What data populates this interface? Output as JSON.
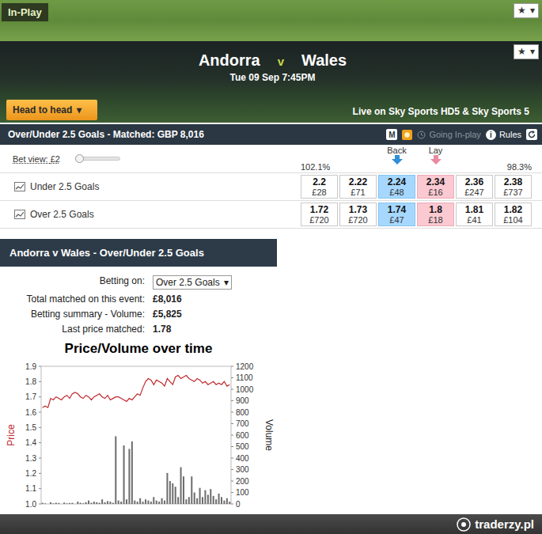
{
  "top_bar": {
    "badge": "In-Play",
    "favourite": {
      "star": "★",
      "arrow": "▾"
    }
  },
  "event": {
    "home": "Andorra",
    "separator": "v",
    "away": "Wales",
    "time": "Tue 09 Sep 7:45PM",
    "favourite": {
      "star": "★",
      "arrow": "▾"
    },
    "head_to_head": {
      "label": "Head to head",
      "arrow": "▾"
    },
    "broadcast": "Live on Sky Sports HD5 & Sky Sports 5"
  },
  "market": {
    "title": "Over/Under 2.5 Goals - Matched: GBP 8,016",
    "tools": {
      "multiples": "M",
      "going_in_play": {
        "label": "Going In-play",
        "disabled": true
      },
      "info": "i",
      "rules": "Rules"
    },
    "bet_view": {
      "label": "Bet view:",
      "value": "£2",
      "level": 0
    },
    "back_label": "Back",
    "lay_label": "Lay",
    "back_book": "102.1%",
    "lay_book": "98.3%",
    "runners": [
      {
        "name": "Under 2.5 Goals",
        "prices": [
          {
            "odds": "2.2",
            "amount": "£28",
            "kind": "back"
          },
          {
            "odds": "2.22",
            "amount": "£71",
            "kind": "back"
          },
          {
            "odds": "2.24",
            "amount": "£48",
            "kind": "bestback"
          },
          {
            "odds": "2.34",
            "amount": "£16",
            "kind": "bestlay"
          },
          {
            "odds": "2.36",
            "amount": "£247",
            "kind": "lay"
          },
          {
            "odds": "2.38",
            "amount": "£737",
            "kind": "lay"
          }
        ]
      },
      {
        "name": "Over 2.5 Goals",
        "prices": [
          {
            "odds": "1.72",
            "amount": "£720",
            "kind": "back"
          },
          {
            "odds": "1.73",
            "amount": "£720",
            "kind": "back"
          },
          {
            "odds": "1.74",
            "amount": "£47",
            "kind": "bestback"
          },
          {
            "odds": "1.8",
            "amount": "£18",
            "kind": "bestlay"
          },
          {
            "odds": "1.81",
            "amount": "£41",
            "kind": "lay"
          },
          {
            "odds": "1.82",
            "amount": "£104",
            "kind": "lay"
          }
        ]
      }
    ]
  },
  "panel": {
    "title": "Andorra v Wales - Over/Under 2.5 Goals",
    "betting_on": {
      "label": "Betting on:",
      "value": "Over 2.5 Goals",
      "arrow": "▾"
    },
    "stats": [
      {
        "label": "Total matched on this event:",
        "value": "£8,016"
      },
      {
        "label": "Betting summary - Volume:",
        "value": "£5,825"
      },
      {
        "label": "Last price matched:",
        "value": "1.78"
      }
    ]
  },
  "chart": {
    "title": "Price/Volume over time",
    "price_axis": {
      "label": "Price",
      "ticks": [
        "1.0",
        "1.1",
        "1.2",
        "1.3",
        "1.4",
        "1.5",
        "1.6",
        "1.7",
        "1.8",
        "1.9"
      ]
    },
    "volume_axis": {
      "label": "Volume",
      "ticks": [
        "0",
        "100",
        "200",
        "300",
        "400",
        "500",
        "600",
        "700",
        "800",
        "900",
        "1000",
        "1100",
        "1200"
      ]
    },
    "price": [
      1.63,
      1.64,
      1.63,
      1.69,
      1.68,
      1.7,
      1.69,
      1.68,
      1.7,
      1.71,
      1.69,
      1.72,
      1.73,
      1.72,
      1.7,
      1.69,
      1.71,
      1.7,
      1.68,
      1.7,
      1.71,
      1.72,
      1.7,
      1.69,
      1.71,
      1.68,
      1.69,
      1.7,
      1.7,
      1.69,
      1.68,
      1.67,
      1.69,
      1.68,
      1.7,
      1.72,
      1.71,
      1.76,
      1.8,
      1.82,
      1.81,
      1.78,
      1.81,
      1.8,
      1.79,
      1.77,
      1.82,
      1.8,
      1.78,
      1.83,
      1.84,
      1.82,
      1.83,
      1.84,
      1.82,
      1.81,
      1.8,
      1.82,
      1.81,
      1.79,
      1.8,
      1.78,
      1.79,
      1.8,
      1.78,
      1.79,
      1.78,
      1.8,
      1.77,
      1.78
    ],
    "volume": [
      10,
      5,
      0,
      15,
      5,
      10,
      8,
      0,
      12,
      5,
      8,
      10,
      0,
      20,
      10,
      5,
      15,
      30,
      10,
      20,
      15,
      10,
      40,
      15,
      25,
      20,
      10,
      590,
      30,
      20,
      510,
      40,
      480,
      545,
      30,
      20,
      50,
      20,
      40,
      30,
      20,
      60,
      30,
      20,
      50,
      30,
      270,
      200,
      180,
      150,
      60,
      320,
      240,
      40,
      60,
      240,
      100,
      50,
      140,
      60,
      120,
      80,
      130,
      70,
      40,
      90,
      60,
      30,
      50,
      20
    ]
  },
  "watermark": "traderzy.pl"
}
